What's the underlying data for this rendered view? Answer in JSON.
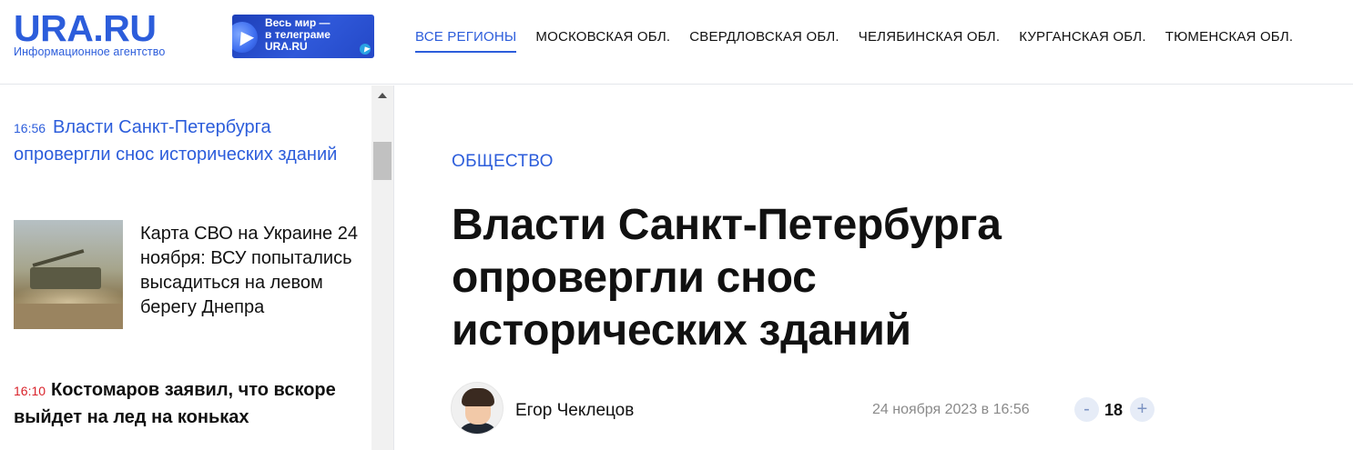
{
  "header": {
    "logo_main": "URA.RU",
    "logo_sub": "Информационное агентство",
    "banner_lines": [
      "Весь мир —",
      "в телеграме",
      "URA.RU"
    ],
    "nav": [
      {
        "label": "ВСЕ РЕГИОНЫ",
        "active": true
      },
      {
        "label": "МОСКОВСКАЯ ОБЛ.",
        "active": false
      },
      {
        "label": "СВЕРДЛОВСКАЯ ОБЛ.",
        "active": false
      },
      {
        "label": "ЧЕЛЯБИНСКАЯ ОБЛ.",
        "active": false
      },
      {
        "label": "КУРГАНСКАЯ ОБЛ.",
        "active": false
      },
      {
        "label": "ТЮМЕНСКАЯ ОБЛ.",
        "active": false
      }
    ]
  },
  "sidebar": {
    "news": [
      {
        "time": "16:56",
        "title": "Власти Санкт-Петербурга опровергли снос исторических зданий"
      },
      {
        "title": "Карта СВО на Украине 24 ноября: ВСУ попытались высадиться на левом берегу Днепра"
      },
      {
        "time": "16:10",
        "title": "Костомаров заявил, что вскоре выйдет на лед на коньках"
      }
    ]
  },
  "article": {
    "category": "ОБЩЕСТВО",
    "title": "Власти Санкт-Петербурга опровергли снос исторических зданий",
    "author": "Егор Чеклецов",
    "date": "24 ноября 2023 в 16:56",
    "rating": "18",
    "minus": "-",
    "plus": "+"
  },
  "colors": {
    "accent": "#2c5ddb",
    "breaking_time": "#d9222a"
  }
}
